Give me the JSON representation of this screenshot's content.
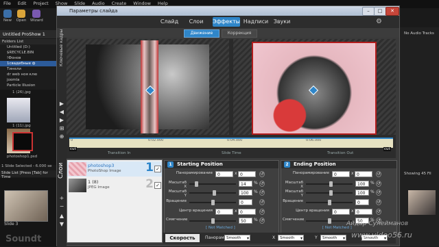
{
  "app": {
    "menu": [
      "File",
      "Edit",
      "Project",
      "Show",
      "Slide",
      "Audio",
      "Create",
      "Window",
      "Help"
    ],
    "toolbar": [
      "New",
      "Open",
      "Wizard"
    ],
    "title": "Untitled ProShow 1",
    "folders_header": "Folders List",
    "folders": [
      "Untitled (D:)",
      "$RECYCLE.BIN",
      "!Фонов",
      "1свадебные ф",
      "Тинели",
      "dr web ноя клю",
      "joomla",
      "Particle Illusion"
    ],
    "thumbs": [
      {
        "label": "1 (26).jpg"
      },
      {
        "label": "1 (11).jpg"
      },
      {
        "label": "photoshop1.psd"
      }
    ],
    "slide_list_label": "Slide List [Press [Tab] for Time",
    "slide_label": "Slide 3",
    "selection_status": "1 Slide Selected - 6.000 se",
    "right_panel": {
      "no_audio": "No Audio Tracks",
      "showing": "Showing 45 Fil"
    },
    "bottom_left_text": "Soundt"
  },
  "dialog": {
    "title": "Параметры слайда",
    "tabs": [
      "Слайд",
      "Слои",
      "Эффекты",
      "Надписи",
      "Звуки"
    ],
    "active_tab": "Эффекты",
    "subtabs": [
      "Движение",
      "Коррекция"
    ],
    "side_label": "Ключевые кадры",
    "timeline": {
      "ticks": [
        "0",
        "0:02.000",
        "0:04.000",
        "0:06.000"
      ],
      "transition_in": "Transition In",
      "slide_time": "Slide Time",
      "transition_out": "Transition Out",
      "cut": "cut"
    },
    "layers_label": "Слои",
    "layers": [
      {
        "name": "photoshop3",
        "type": "PhotoShop Image",
        "num": "1",
        "checked": "✓"
      },
      {
        "name": "1 (8)",
        "type": "JPEG Image",
        "num": "2",
        "checked": "✓"
      }
    ],
    "start": {
      "header": "Starting Position",
      "num": "1",
      "labels": {
        "pan": "Панорамирование",
        "scale_x": "Масштаб X",
        "scale_y": "Масштаб Y",
        "rotate": "Вращение",
        "center": "Центр вращения",
        "smooth": "Смягчение"
      },
      "pan_x": "0",
      "pan_y": "0",
      "scale_x": "14",
      "scale_y": "100",
      "rotate": "0",
      "center_x": "0",
      "center_y": "0",
      "smooth": "50",
      "not_matched": "[ Not Matched ]"
    },
    "end": {
      "header": "Ending Position",
      "num": "2",
      "labels": {
        "pan": "Панорамирование",
        "scale_x": "Масштаб X",
        "scale_y": "Масштаб Y",
        "rotate": "Вращение",
        "center": "Центр вращения",
        "smooth": "Смягчение"
      },
      "pan_x": "0",
      "pan_y": "0",
      "scale_x": "100",
      "scale_y": "100",
      "rotate": "0",
      "center_x": "0",
      "center_y": "0",
      "smooth": "50",
      "not_matched": "[ Not Matched ]"
    },
    "bottom": {
      "speed": "Скорость",
      "pan_label": "Панорама",
      "pan_value": "Smooth",
      "x_label": "X",
      "x_value": "Smooth",
      "y_label": "Y",
      "y_value": "Smooth",
      "rot_label": "",
      "rot_value": "Smooth"
    },
    "colors": {
      "accent": "#2f86c9",
      "dialog_bg": "#3a3a3a"
    }
  },
  "watermark": {
    "author": "Айдар Сулейманов",
    "site": "www.video56.ru"
  }
}
